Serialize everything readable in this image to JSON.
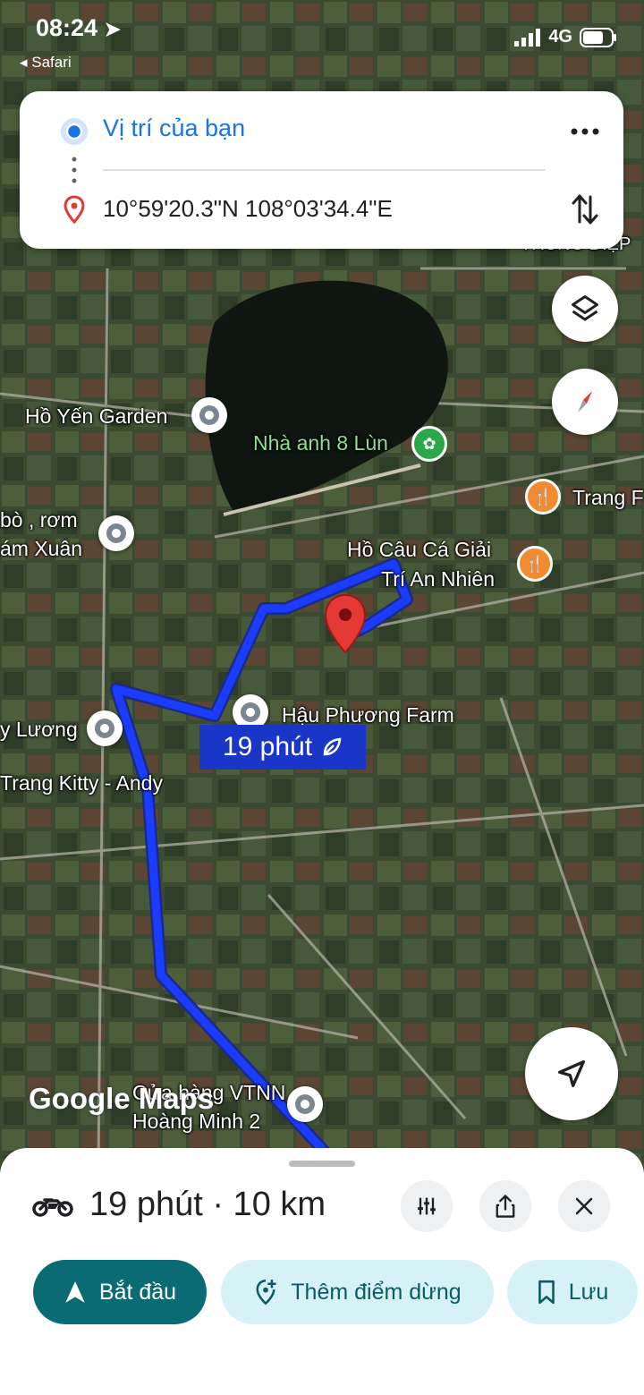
{
  "status_bar": {
    "time": "08:24",
    "back_label": "◂ Safari",
    "network": "4G"
  },
  "route_card": {
    "origin": "Vị trí của bạn",
    "destination": "10°59'20.3\"N 108°03'34.4\"E"
  },
  "map": {
    "labels": {
      "trung_diep": "TRUNG DIỆP",
      "ho_yen": "Hồ Yến Garden",
      "nha_anh": "Nhà anh 8 Lùn",
      "trang_f": "Trang F",
      "bo_rom": "bò , rơm",
      "am_xuan": "ám Xuân",
      "ho_cau_1": "Hồ Câu Cá Giải",
      "ho_cau_2": "Trí An Nhiên",
      "hau_phuong": "Hậu Phương Farm",
      "luong": "y Lương",
      "trang_kitty": "Trang Kitty - Andy",
      "vtnn_1": "Cửa hàng VTNN",
      "vtnn_2": "Hoàng Minh 2"
    },
    "eta_badge": "19 phút",
    "watermark": "Google Maps"
  },
  "sheet": {
    "summary": "19 phút · 10 km",
    "start_label": "Bắt đầu",
    "add_stop_label": "Thêm điểm dừng",
    "save_label": "Lưu"
  },
  "colors": {
    "route": "#1a3cff",
    "accent": "#0b6b74",
    "pill_secondary": "#d6f2f6"
  }
}
